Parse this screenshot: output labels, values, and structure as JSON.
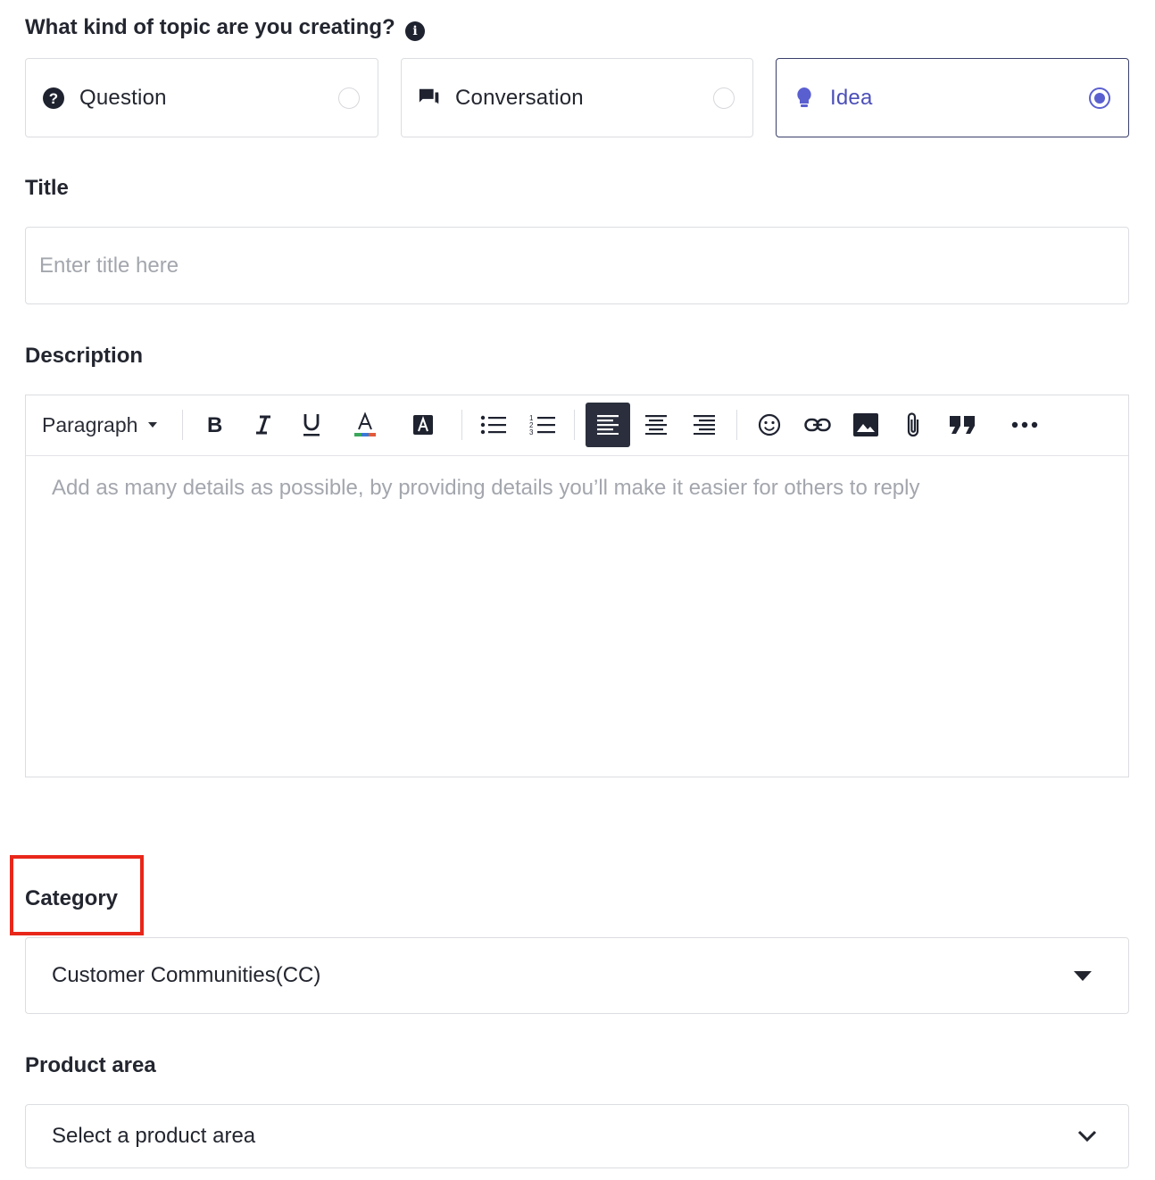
{
  "topic_type": {
    "heading": "What kind of topic are you creating?",
    "info_icon": "info-icon",
    "options": [
      {
        "label": "Question",
        "icon": "question-circle-icon",
        "selected": false
      },
      {
        "label": "Conversation",
        "icon": "chat-bubbles-icon",
        "selected": false
      },
      {
        "label": "Idea",
        "icon": "lightbulb-icon",
        "selected": true
      }
    ]
  },
  "title": {
    "label": "Title",
    "placeholder": "Enter title here",
    "value": ""
  },
  "description": {
    "label": "Description",
    "toolbar": {
      "block_format": "Paragraph",
      "buttons": [
        "bold-icon",
        "italic-icon",
        "underline-icon",
        "text-color-icon",
        "highlight-icon",
        "bullet-list-icon",
        "numbered-list-icon",
        "align-left-icon",
        "align-center-icon",
        "align-right-icon",
        "emoji-icon",
        "link-icon",
        "image-icon",
        "attachment-icon",
        "quote-icon",
        "more-icon"
      ],
      "active_button": "align-left-icon"
    },
    "placeholder": "Add as many details as possible, by providing details you’ll make it easier for others to reply"
  },
  "category": {
    "label": "Category",
    "value": "Customer Communities(CC)"
  },
  "product_area": {
    "label": "Product area",
    "value": "Select a product area"
  },
  "colors": {
    "accent": "#5a5fd0",
    "selected_text": "#4b4fb8",
    "highlight_box": "#e8271a",
    "active_toolbar_bg": "#2b2f3d"
  }
}
